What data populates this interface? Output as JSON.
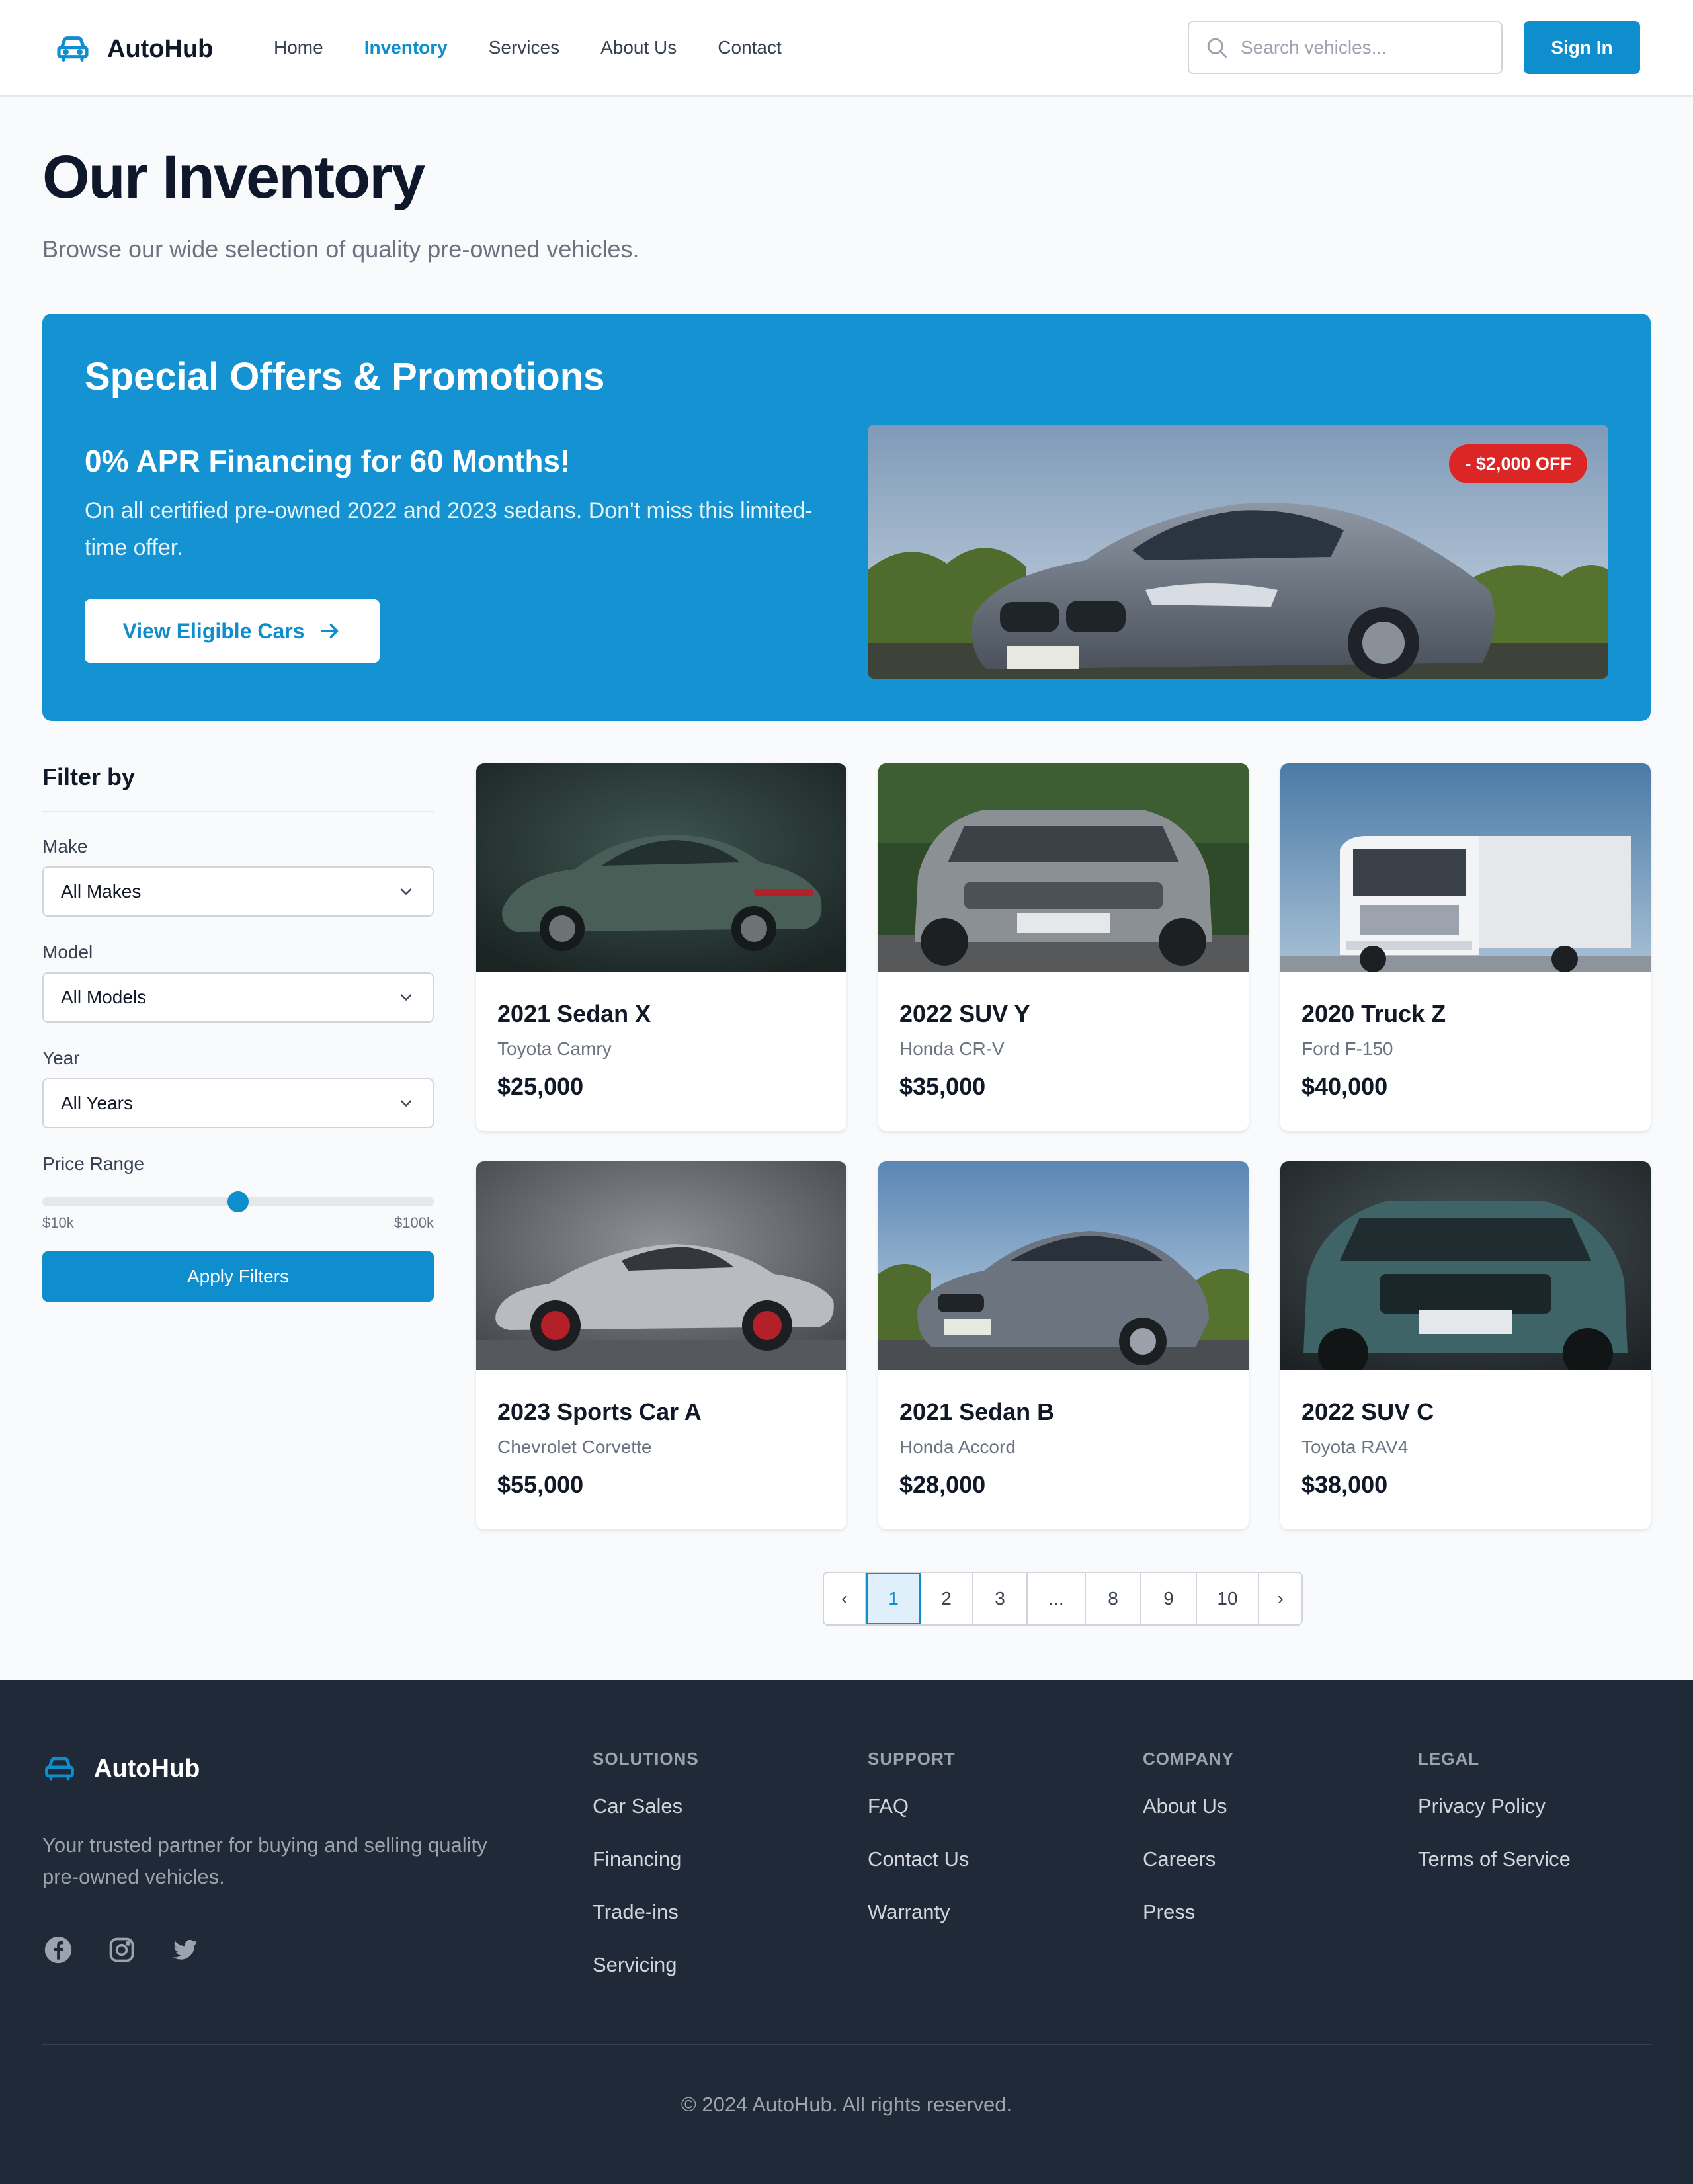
{
  "header": {
    "brand": "AutoHub",
    "nav": [
      "Home",
      "Inventory",
      "Services",
      "About Us",
      "Contact"
    ],
    "active_nav": "Inventory",
    "search_placeholder": "Search vehicles...",
    "signin_label": "Sign In"
  },
  "page": {
    "title": "Our Inventory",
    "subtitle": "Browse our wide selection of quality pre-owned vehicles."
  },
  "promo": {
    "title": "Special Offers & Promotions",
    "headline": "0% APR Financing for 60 Months!",
    "description": "On all certified pre-owned 2022 and 2023 sedans. Don't miss this limited-time offer.",
    "button_label": "View Eligible Cars",
    "badge": "- $2,000 OFF"
  },
  "filters": {
    "heading": "Filter by",
    "make_label": "Make",
    "make_value": "All Makes",
    "model_label": "Model",
    "model_value": "All Models",
    "year_label": "Year",
    "year_value": "All Years",
    "price_label": "Price Range",
    "price_min": "$10k",
    "price_max": "$100k",
    "price_slider_fraction": 0.5,
    "apply_label": "Apply Filters"
  },
  "vehicles": [
    {
      "title": "2021 Sedan X",
      "model": "Toyota Camry",
      "price": "$25,000",
      "color": "#4a5e58"
    },
    {
      "title": "2022 SUV Y",
      "model": "Honda CR-V",
      "price": "$35,000",
      "color": "#8a9094"
    },
    {
      "title": "2020 Truck Z",
      "model": "Ford F-150",
      "price": "$40,000",
      "color": "#e5e7eb"
    },
    {
      "title": "2023 Sports Car A",
      "model": "Chevrolet Corvette",
      "price": "$55,000",
      "color": "#b8bcc0"
    },
    {
      "title": "2021 Sedan B",
      "model": "Honda Accord",
      "price": "$28,000",
      "color": "#6c7480"
    },
    {
      "title": "2022 SUV C",
      "model": "Toyota RAV4",
      "price": "$38,000",
      "color": "#3f6468"
    }
  ],
  "pagination": {
    "prev": "‹",
    "pages": [
      "1",
      "2",
      "3",
      "...",
      "8",
      "9",
      "10"
    ],
    "current": "1",
    "next": "›"
  },
  "footer": {
    "brand": "AutoHub",
    "tagline": "Your trusted partner for buying and selling quality pre-owned vehicles.",
    "columns": [
      {
        "heading": "SOLUTIONS",
        "links": [
          "Car Sales",
          "Financing",
          "Trade-ins",
          "Servicing"
        ]
      },
      {
        "heading": "SUPPORT",
        "links": [
          "FAQ",
          "Contact Us",
          "Warranty"
        ]
      },
      {
        "heading": "COMPANY",
        "links": [
          "About Us",
          "Careers",
          "Press"
        ]
      },
      {
        "heading": "LEGAL",
        "links": [
          "Privacy Policy",
          "Terms of Service"
        ]
      }
    ],
    "socials": [
      "facebook-icon",
      "instagram-icon",
      "twitter-icon"
    ],
    "copyright": "© 2024 AutoHub. All rights reserved."
  },
  "colors": {
    "accent": "#0f8ece",
    "promo_bg": "#1592d1",
    "badge": "#dc2626",
    "footer_bg": "#1f2937"
  }
}
